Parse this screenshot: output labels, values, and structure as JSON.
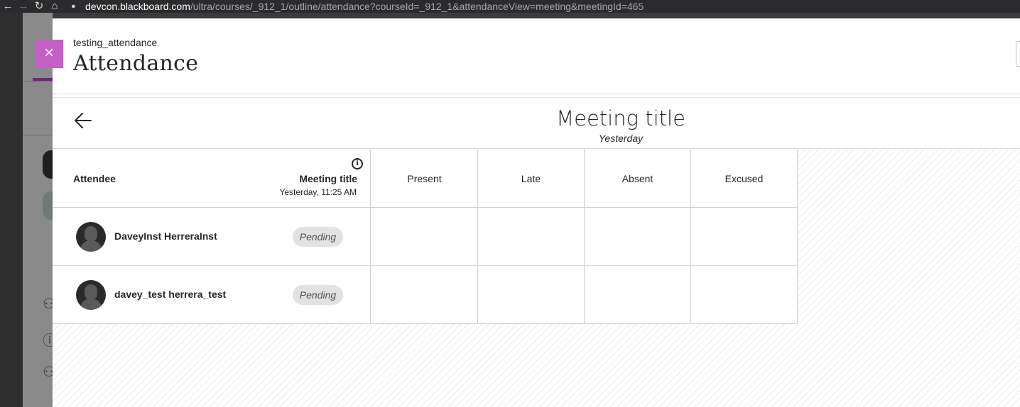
{
  "browser": {
    "url_host": "devcon.blackboard.com",
    "url_path": "/ultra/courses/_912_1/outline/attendance?courseId=_912_1&attendanceView=meeting&meetingId=465"
  },
  "panel": {
    "course_name": "testing_attendance",
    "title": "Attendance",
    "close_label": "×"
  },
  "meeting": {
    "title": "Meeting title",
    "date": "Yesterday"
  },
  "table": {
    "attendee_header": "Attendee",
    "meeting_header": "Meeting title",
    "meeting_header_date": "Yesterday, 11:25 AM",
    "status_columns": [
      "Present",
      "Late",
      "Absent",
      "Excused"
    ],
    "rows": [
      {
        "name": "DaveyInst HerreraInst",
        "status": "Pending"
      },
      {
        "name": "davey_test herrera_test",
        "status": "Pending"
      }
    ]
  },
  "colors": {
    "close_button": "#c45fc7",
    "text": "#262626",
    "pending_bg": "#e2e2e2"
  }
}
